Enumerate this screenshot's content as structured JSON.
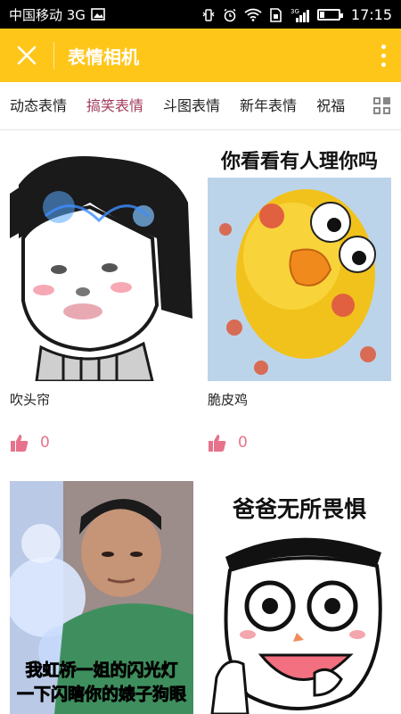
{
  "status_bar": {
    "carrier": "中国移动 3G",
    "time": "17:15",
    "signal_label": "3G"
  },
  "app_bar": {
    "title": "表情相机"
  },
  "tabs": {
    "items": [
      "动态表情",
      "搞笑表情",
      "斗图表情",
      "新年表情",
      "祝福"
    ],
    "active_index": 1
  },
  "cards": [
    {
      "title": "吹头帘",
      "likes": "0"
    },
    {
      "title": "脆皮鸡",
      "likes": "0",
      "overlay_text": "你看看有人理你吗"
    },
    {
      "title": "",
      "likes": "",
      "overlay_text_1": "我虹桥一姐的闪光灯",
      "overlay_text_2": "一下闪瞎你的婊子狗眼"
    },
    {
      "title": "",
      "likes": "",
      "overlay_text": "爸爸无所畏惧"
    }
  ],
  "colors": {
    "app_bar": "#ffc61a",
    "active_tab": "#a33a5a",
    "like": "#e7728c"
  }
}
